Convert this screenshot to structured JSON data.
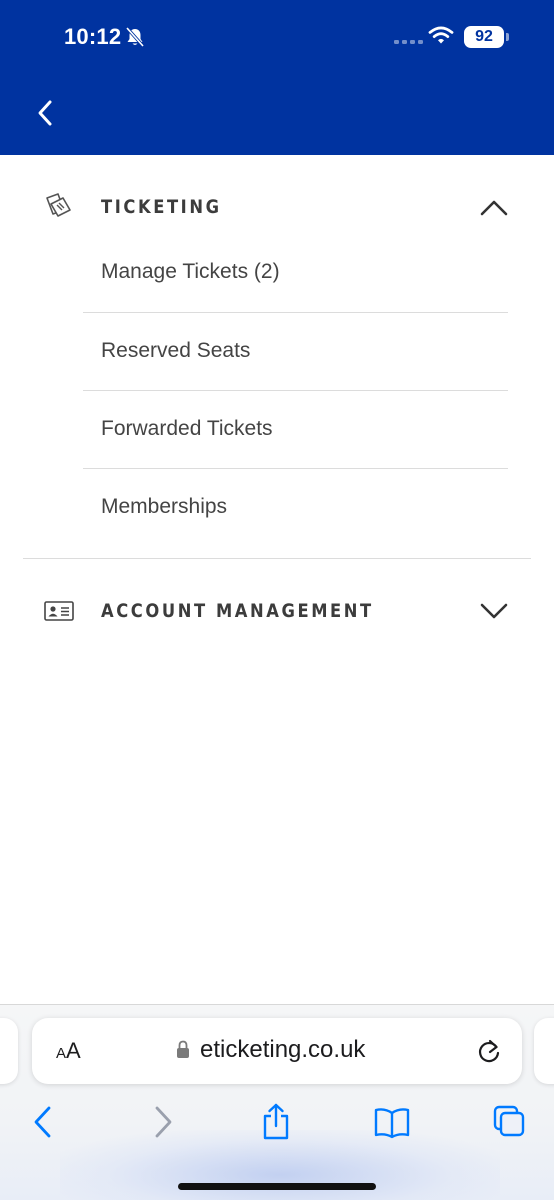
{
  "status_bar": {
    "time": "10:12",
    "battery": "92",
    "icons": [
      "bell-slash-icon",
      "signal-icon",
      "wifi-icon",
      "battery-icon"
    ]
  },
  "header": {
    "background": "#0033a0",
    "back_icon": "chevron-left-icon"
  },
  "menu": {
    "sections": [
      {
        "title": "TICKETING",
        "icon": "tickets-icon",
        "expanded": true,
        "chevron": "chevron-up-icon",
        "items": [
          {
            "label": "Manage Tickets (2)"
          },
          {
            "label": "Reserved Seats"
          },
          {
            "label": "Forwarded Tickets"
          },
          {
            "label": "Memberships"
          }
        ]
      },
      {
        "title": "ACCOUNT MANAGEMENT",
        "icon": "id-card-icon",
        "expanded": false,
        "chevron": "chevron-down-icon",
        "items": []
      }
    ]
  },
  "browser": {
    "text_size_label": "AA",
    "url": "eticketing.co.uk",
    "accent": "#007aff",
    "toolbar": [
      "back-icon",
      "forward-icon",
      "share-icon",
      "bookmarks-icon",
      "tabs-icon"
    ]
  }
}
